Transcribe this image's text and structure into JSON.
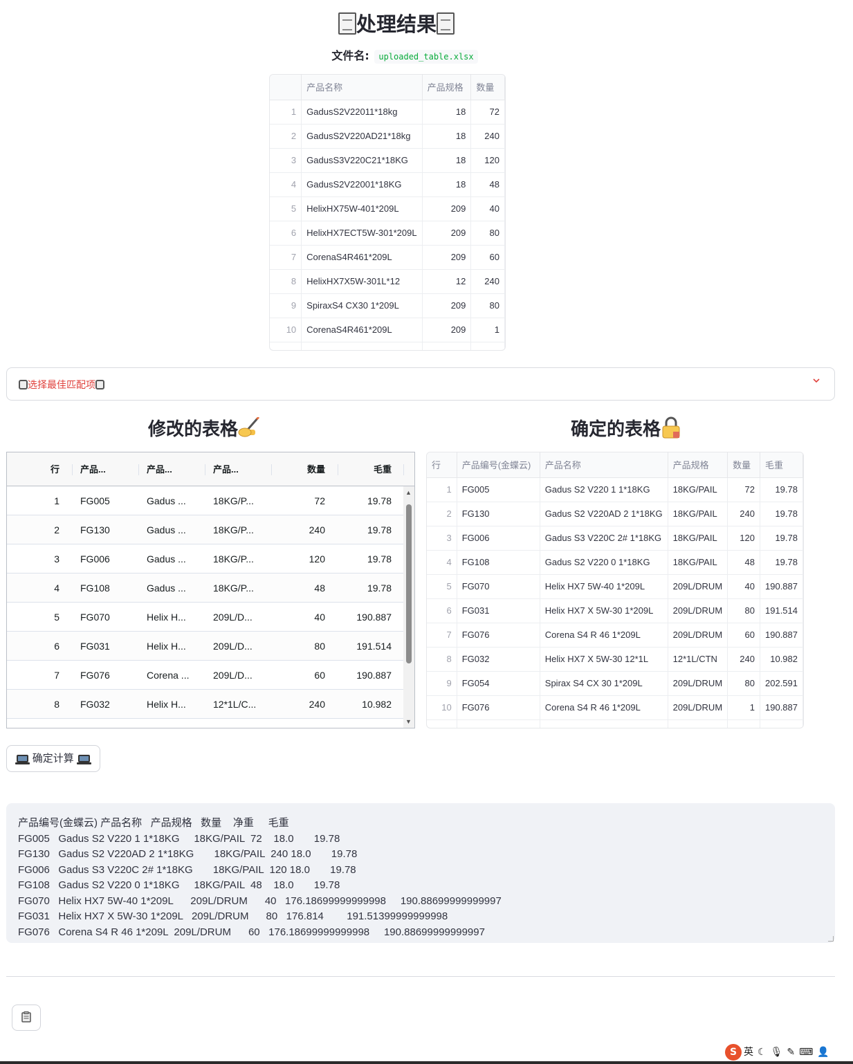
{
  "title": "处理结果",
  "file_label": "文件名:",
  "file_name": "uploaded_table.xlsx",
  "uploaded_table": {
    "columns": [
      "",
      "产品名称",
      "产品规格",
      "数量"
    ],
    "rows": [
      [
        "1",
        "GadusS2V22011*18kg",
        "18",
        "72"
      ],
      [
        "2",
        "GadusS2V220AD21*18kg",
        "18",
        "240"
      ],
      [
        "3",
        "GadusS3V220C21*18KG",
        "18",
        "120"
      ],
      [
        "4",
        "GadusS2V22001*18KG",
        "18",
        "48"
      ],
      [
        "5",
        "HelixHX75W-401*209L",
        "209",
        "40"
      ],
      [
        "6",
        "HelixHX7ECT5W-301*209L",
        "209",
        "80"
      ],
      [
        "7",
        "CorenaS4R461*209L",
        "209",
        "60"
      ],
      [
        "8",
        "HelixHX7X5W-301L*12",
        "12",
        "240"
      ],
      [
        "9",
        "SpiraxS4 CX30 1*209L",
        "209",
        "80"
      ],
      [
        "10",
        "CorenaS4R461*209L",
        "209",
        "1"
      ]
    ]
  },
  "expander": {
    "label": "选择最佳匹配项",
    "icon": "chevron-down-icon"
  },
  "modified_table": {
    "title": "修改的表格",
    "title_icon": "writing-hand-icon",
    "columns": [
      "行",
      "产品...",
      "产品...",
      "产品...",
      "数量",
      "毛重"
    ],
    "rows": [
      [
        "1",
        "FG005",
        "Gadus ...",
        "18KG/P...",
        "72",
        "19.78"
      ],
      [
        "2",
        "FG130",
        "Gadus ...",
        "18KG/P...",
        "240",
        "19.78"
      ],
      [
        "3",
        "FG006",
        "Gadus ...",
        "18KG/P...",
        "120",
        "19.78"
      ],
      [
        "4",
        "FG108",
        "Gadus ...",
        "18KG/P...",
        "48",
        "19.78"
      ],
      [
        "5",
        "FG070",
        "Helix H...",
        "209L/D...",
        "40",
        "190.887"
      ],
      [
        "6",
        "FG031",
        "Helix H...",
        "209L/D...",
        "80",
        "191.514"
      ],
      [
        "7",
        "FG076",
        "Corena ...",
        "209L/D...",
        "60",
        "190.887"
      ],
      [
        "8",
        "FG032",
        "Helix H...",
        "12*1L/C...",
        "240",
        "10.982"
      ]
    ]
  },
  "confirmed_table": {
    "title": "确定的表格",
    "title_icon": "lock-icon",
    "columns": [
      "行",
      "产品编号(金蝶云)",
      "产品名称",
      "产品规格",
      "数量",
      "毛重"
    ],
    "rows": [
      [
        "1",
        "FG005",
        "Gadus S2 V220 1 1*18KG",
        "18KG/PAIL",
        "72",
        "19.78"
      ],
      [
        "2",
        "FG130",
        "Gadus S2 V220AD 2 1*18KG",
        "18KG/PAIL",
        "240",
        "19.78"
      ],
      [
        "3",
        "FG006",
        "Gadus S3 V220C 2# 1*18KG",
        "18KG/PAIL",
        "120",
        "19.78"
      ],
      [
        "4",
        "FG108",
        "Gadus S2 V220 0 1*18KG",
        "18KG/PAIL",
        "48",
        "19.78"
      ],
      [
        "5",
        "FG070",
        "Helix HX7 5W-40 1*209L",
        "209L/DRUM",
        "40",
        "190.887"
      ],
      [
        "6",
        "FG031",
        "Helix HX7 X 5W-30 1*209L",
        "209L/DRUM",
        "80",
        "191.514"
      ],
      [
        "7",
        "FG076",
        "Corena S4 R 46 1*209L",
        "209L/DRUM",
        "60",
        "190.887"
      ],
      [
        "8",
        "FG032",
        "Helix HX7 X 5W-30 12*1L",
        "12*1L/CTN",
        "240",
        "10.982"
      ],
      [
        "9",
        "FG054",
        "Spirax S4 CX 30 1*209L",
        "209L/DRUM",
        "80",
        "202.591"
      ],
      [
        "10",
        "FG076",
        "Corena S4 R 46 1*209L",
        "209L/DRUM",
        "1",
        "190.887"
      ]
    ]
  },
  "confirm_button": "确定计算",
  "result_text": "产品编号(金蝶云) 产品名称   产品规格   数量    净重     毛重\nFG005   Gadus S2 V220 1 1*18KG     18KG/PAIL  72    18.0       19.78\nFG130   Gadus S2 V220AD 2 1*18KG       18KG/PAIL  240 18.0       19.78\nFG006   Gadus S3 V220C 2# 1*18KG       18KG/PAIL  120 18.0       19.78\nFG108   Gadus S2 V220 0 1*18KG     18KG/PAIL  48    18.0       19.78\nFG070   Helix HX7 5W-40 1*209L      209L/DRUM      40   176.18699999999998     190.88699999999997\nFG031   Helix HX7 X 5W-30 1*209L   209L/DRUM      80   176.814        191.51399999999998\nFG076   Corena S4 R 46 1*209L  209L/DRUM      60   176.18699999999998     190.88699999999997",
  "copy_icon": "clipboard-icon",
  "ime": {
    "lang": "英"
  }
}
